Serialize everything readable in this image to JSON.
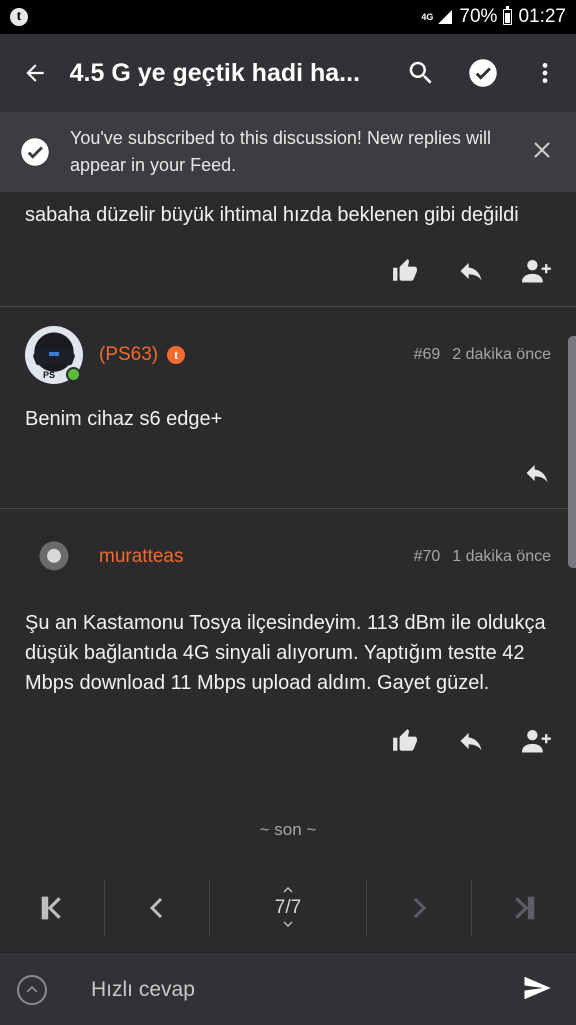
{
  "status_bar": {
    "network": "4G",
    "battery": "70%",
    "time": "01:27",
    "app_icon": "tapatalk-icon"
  },
  "header": {
    "title": "4.5 G ye geçtik hadi ha..."
  },
  "banner": {
    "message": "You've subscribed to this discussion! New replies will appear in your Feed."
  },
  "posts": [
    {
      "text": "sabaha düzelir büyük ihtimal hızda beklenen gibi değildi"
    },
    {
      "username": "(PS63)",
      "number": "#69",
      "time": "2 dakika önce",
      "text": "Benim cihaz s6 edge+",
      "online": true
    },
    {
      "username": "muratteas",
      "number": "#70",
      "time": "1 dakika önce",
      "text": "Şu an Kastamonu Tosya ilçesindeyim. 113 dBm ile oldukça düşük bağlantıda 4G sinyali alıyorum. Yaptığım testte 42 Mbps download 11 Mbps upload aldım. Gayet güzel."
    }
  ],
  "end_marker": "~ son ~",
  "pagination": {
    "current": "7/7"
  },
  "quick_reply": {
    "placeholder": "Hızlı cevap"
  },
  "colors": {
    "accent": "#f26a2c",
    "background": "#2b2b2e",
    "appbar": "#323236"
  }
}
